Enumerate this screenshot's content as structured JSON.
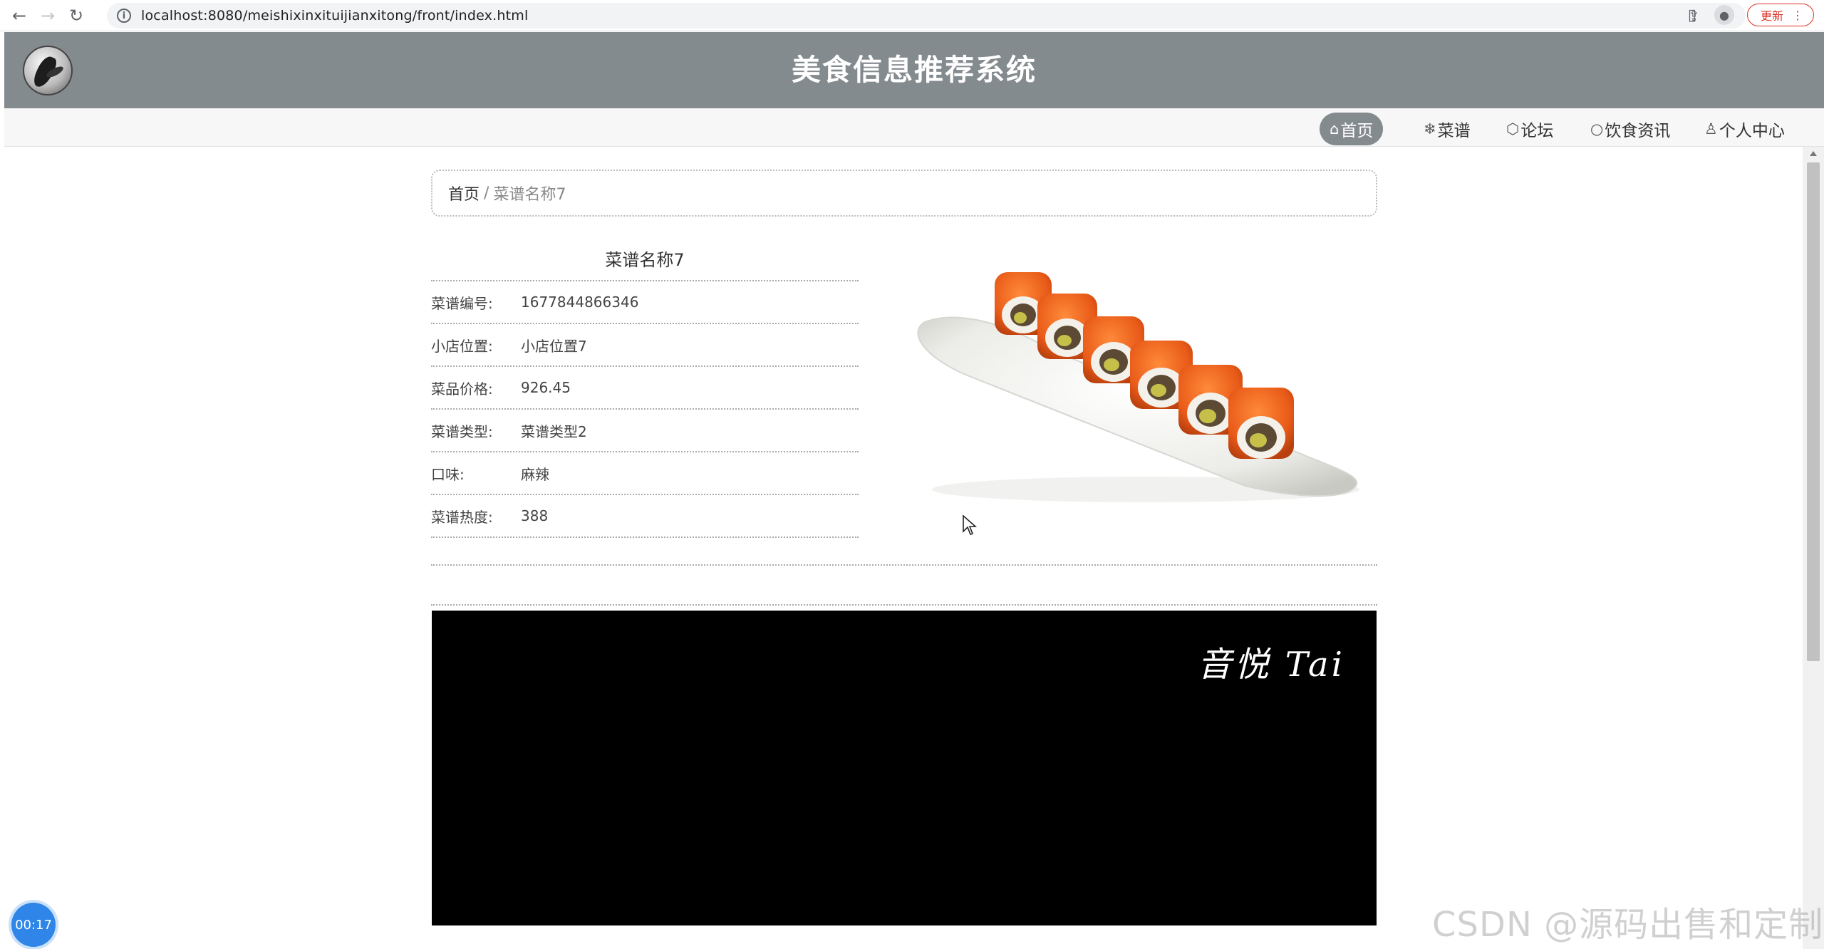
{
  "browser": {
    "url": "localhost:8080/meishixinxituijianxitong/front/index.html",
    "update_label": "更新"
  },
  "site": {
    "title": "美食信息推荐系统"
  },
  "nav": {
    "items": [
      {
        "label": "首页",
        "icon": "home-icon",
        "active": true
      },
      {
        "label": "菜谱",
        "icon": "snowflake-icon"
      },
      {
        "label": "论坛",
        "icon": "tag-icon"
      },
      {
        "label": "饮食资讯",
        "icon": "circle-icon"
      },
      {
        "label": "个人中心",
        "icon": "user-icon"
      }
    ]
  },
  "breadcrumb": {
    "home": "首页",
    "separator": "/",
    "current": "菜谱名称7"
  },
  "recipe": {
    "title": "菜谱名称7",
    "fields": [
      {
        "label": "菜谱编号:",
        "value": "1677844866346"
      },
      {
        "label": "小店位置:",
        "value": "小店位置7"
      },
      {
        "label": "菜品价格:",
        "value": "926.45"
      },
      {
        "label": "菜谱类型:",
        "value": "菜谱类型2"
      },
      {
        "label": "口味:",
        "value": "麻辣"
      },
      {
        "label": "菜谱热度:",
        "value": "388"
      }
    ]
  },
  "video": {
    "signature": "音悦 Tai"
  },
  "overlay": {
    "timer": "00:17",
    "watermark": "CSDN @源码出售和定制"
  }
}
